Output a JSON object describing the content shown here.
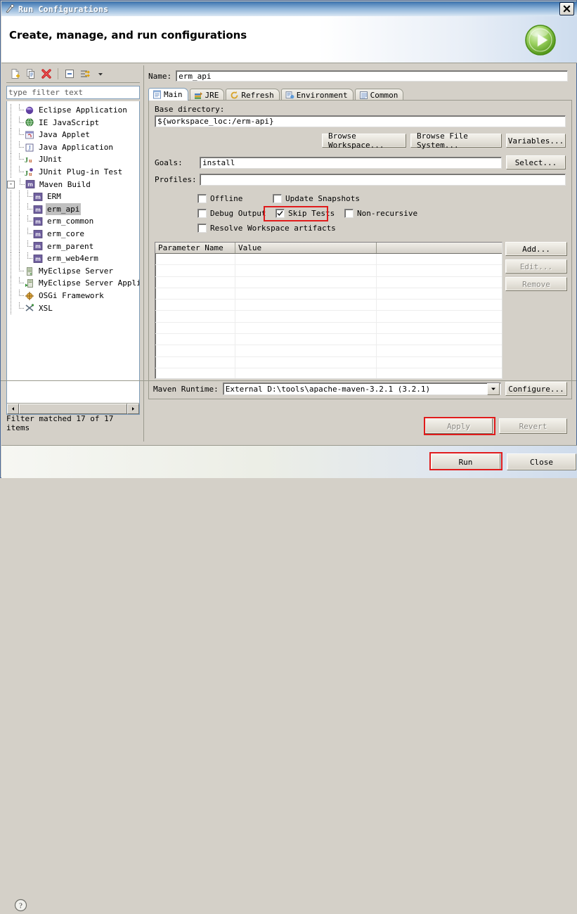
{
  "window": {
    "title": "Run Configurations",
    "close_label": "Close window",
    "header_title": "Create, manage, and run configurations",
    "run_badge_icon": "green-play-icon",
    "help_icon": "help-question-icon"
  },
  "left_toolbar": {
    "buttons": [
      {
        "name": "new-configuration-button",
        "icon": "new-document-icon"
      },
      {
        "name": "duplicate-configuration-button",
        "icon": "copy-icon"
      },
      {
        "name": "delete-configuration-button",
        "icon": "delete-red-x-icon"
      },
      {
        "name": "collapse-all-button",
        "icon": "collapse-all-icon"
      },
      {
        "name": "filter-button",
        "icon": "filter-arrow-icon"
      },
      {
        "name": "view-menu-button",
        "icon": "chevron-down-icon"
      }
    ]
  },
  "filter": {
    "placeholder": "type filter text",
    "value": "",
    "status": "Filter matched 17 of 17 items"
  },
  "tree": {
    "items": [
      {
        "label": "Eclipse Application",
        "icon": "eclipse-sphere-icon",
        "indent": 1,
        "selected": false,
        "expander": ""
      },
      {
        "label": "IE JavaScript",
        "icon": "globe-icon",
        "indent": 1,
        "selected": false,
        "expander": ""
      },
      {
        "label": "Java Applet",
        "icon": "java-applet-icon",
        "indent": 1,
        "selected": false,
        "expander": ""
      },
      {
        "label": "Java Application",
        "icon": "java-application-icon",
        "indent": 1,
        "selected": false,
        "expander": ""
      },
      {
        "label": "JUnit",
        "icon": "junit-icon",
        "indent": 1,
        "selected": false,
        "expander": ""
      },
      {
        "label": "JUnit Plug-in Test",
        "icon": "junit-plugin-icon",
        "indent": 1,
        "selected": false,
        "expander": ""
      },
      {
        "label": "Maven Build",
        "icon": "maven-icon",
        "indent": 1,
        "selected": false,
        "expander": "-"
      },
      {
        "label": "ERM",
        "icon": "maven-icon",
        "indent": 2,
        "selected": false,
        "expander": ""
      },
      {
        "label": "erm_api",
        "icon": "maven-icon",
        "indent": 2,
        "selected": true,
        "expander": ""
      },
      {
        "label": "erm_common",
        "icon": "maven-icon",
        "indent": 2,
        "selected": false,
        "expander": ""
      },
      {
        "label": "erm_core",
        "icon": "maven-icon",
        "indent": 2,
        "selected": false,
        "expander": ""
      },
      {
        "label": "erm_parent",
        "icon": "maven-icon",
        "indent": 2,
        "selected": false,
        "expander": ""
      },
      {
        "label": "erm_web4erm",
        "icon": "maven-icon",
        "indent": 2,
        "selected": false,
        "expander": ""
      },
      {
        "label": "MyEclipse Server",
        "icon": "server-icon",
        "indent": 1,
        "selected": false,
        "expander": ""
      },
      {
        "label": "MyEclipse Server Appli",
        "icon": "server-application-icon",
        "indent": 1,
        "selected": false,
        "expander": ""
      },
      {
        "label": "OSGi Framework",
        "icon": "osgi-icon",
        "indent": 1,
        "selected": false,
        "expander": ""
      },
      {
        "label": "XSL",
        "icon": "xsl-icon",
        "indent": 1,
        "selected": false,
        "expander": ""
      }
    ]
  },
  "form": {
    "name_label": "Name:",
    "name_value": "erm_api",
    "tabs": [
      {
        "label": "Main",
        "icon": "main-tab-icon",
        "active": true
      },
      {
        "label": "JRE",
        "icon": "jre-tab-icon",
        "active": false
      },
      {
        "label": "Refresh",
        "icon": "refresh-tab-icon",
        "active": false
      },
      {
        "label": "Environment",
        "icon": "environment-tab-icon",
        "active": false
      },
      {
        "label": "Common",
        "icon": "common-tab-icon",
        "active": false
      }
    ],
    "base_directory_label": "Base directory:",
    "base_directory_value": "${workspace_loc:/erm-api}",
    "browse_workspace_label": "Browse Workspace...",
    "browse_filesystem_label": "Browse File System...",
    "variables_label": "Variables...",
    "goals_label": "Goals:",
    "goals_value": "install",
    "select_label": "Select...",
    "profiles_label": "Profiles:",
    "profiles_value": "",
    "checkboxes": [
      {
        "label": "Offline",
        "checked": false,
        "highlighted": false
      },
      {
        "label": "Update Snapshots",
        "checked": false,
        "highlighted": false
      },
      {
        "label": "Debug Output",
        "checked": false,
        "highlighted": false
      },
      {
        "label": "Skip Tests",
        "checked": true,
        "highlighted": true
      },
      {
        "label": "Non-recursive",
        "checked": false,
        "highlighted": false
      },
      {
        "label": "Resolve Workspace artifacts",
        "checked": false,
        "highlighted": false
      }
    ],
    "table": {
      "columns": [
        "Parameter Name",
        "Value",
        ""
      ],
      "rows": [],
      "empty_row_count": 12
    },
    "table_buttons": [
      {
        "label": "Add...",
        "enabled": true,
        "name": "add-parameter-button"
      },
      {
        "label": "Edit...",
        "enabled": false,
        "name": "edit-parameter-button"
      },
      {
        "label": "Remove",
        "enabled": false,
        "name": "remove-parameter-button"
      }
    ],
    "maven_runtime_label": "Maven Runtime:",
    "maven_runtime_value": "External D:\\tools\\apache-maven-3.2.1  (3.2.1)",
    "configure_label": "Configure..."
  },
  "actions": {
    "apply_label": "Apply",
    "apply_enabled": false,
    "apply_highlighted": true,
    "revert_label": "Revert",
    "revert_enabled": false,
    "run_label": "Run",
    "run_highlighted": true,
    "close_label": "Close"
  },
  "colors": {
    "highlight_red": "#e01b1b",
    "dialog_bg": "#d4d0c8",
    "title_blue": "#4d81b8",
    "selection_gray": "#c0c0c0"
  }
}
